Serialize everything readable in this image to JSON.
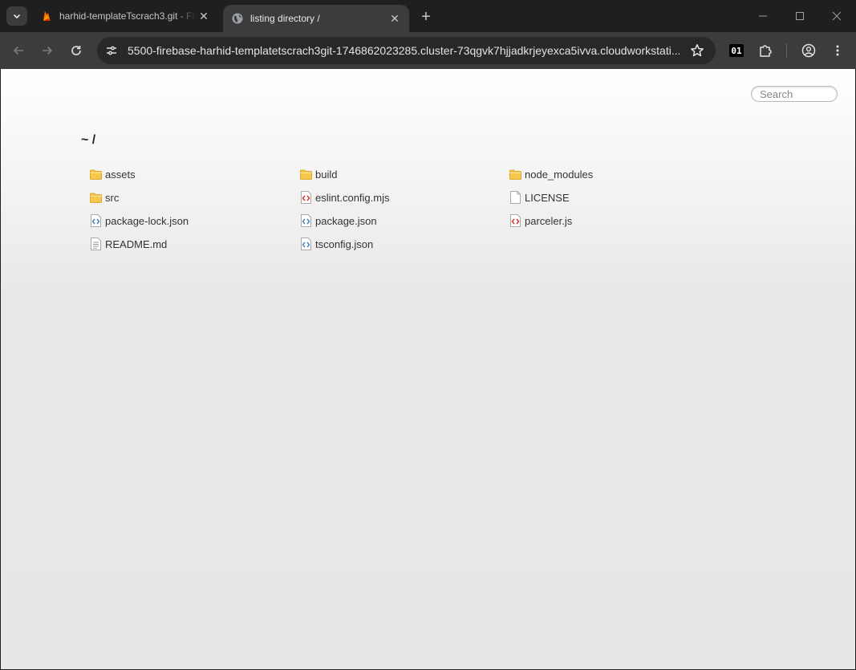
{
  "browser": {
    "tabs": [
      {
        "title": "harhid-templateTscrach3.git - Fi",
        "favicon": "firebase-icon",
        "active": false
      },
      {
        "title": "listing directory /",
        "favicon": "globe-icon",
        "active": true
      }
    ],
    "address_bar": {
      "url": "5500-firebase-harhid-templatetscrach3git-1746862023285.cluster-73qgvk7hjjadkrjeyexca5ivva.cloudworkstati..."
    },
    "extension_badge": "01"
  },
  "page": {
    "search_placeholder": "Search",
    "path": "~ /",
    "files": [
      {
        "name": "assets",
        "type": "folder"
      },
      {
        "name": "build",
        "type": "folder"
      },
      {
        "name": "node_modules",
        "type": "folder"
      },
      {
        "name": "src",
        "type": "folder"
      },
      {
        "name": "eslint.config.mjs",
        "type": "js"
      },
      {
        "name": "LICENSE",
        "type": "file"
      },
      {
        "name": "package-lock.json",
        "type": "json"
      },
      {
        "name": "package.json",
        "type": "json"
      },
      {
        "name": "parceler.js",
        "type": "js"
      },
      {
        "name": "README.md",
        "type": "text"
      },
      {
        "name": "tsconfig.json",
        "type": "json"
      }
    ]
  }
}
